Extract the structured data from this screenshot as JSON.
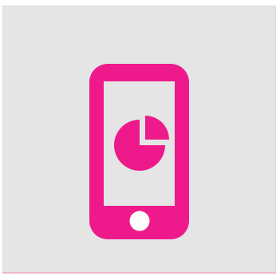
{
  "icon": {
    "name": "smartphone-pie-chart-icon",
    "accent_color": "#EE1A8C",
    "background_color": "#E5E5E5"
  }
}
